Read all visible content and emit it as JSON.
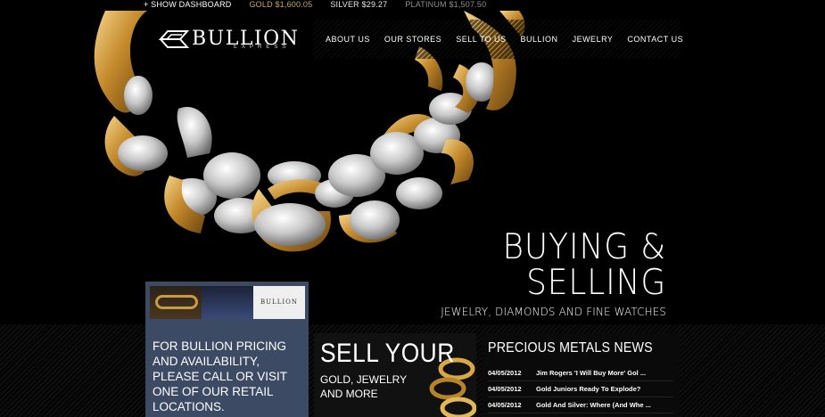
{
  "ticker": {
    "dashboard": "+ SHOW DASHBOARD",
    "gold": "GOLD $1,600.05",
    "silver": "SILVER $29.27",
    "platinum": "PLATINUM $1,507.50"
  },
  "logo": {
    "main": "BULLION",
    "sub": "EXPRESS"
  },
  "nav": [
    {
      "label": "ABOUT US"
    },
    {
      "label": "OUR STORES"
    },
    {
      "label": "SELL TO US"
    },
    {
      "label": "BULLION"
    },
    {
      "label": "JEWELRY"
    },
    {
      "label": "CONTACT US"
    }
  ],
  "hero": {
    "line1": "BUYING &",
    "line2": "SELLING",
    "subline": "JEWELRY, DIAMONDS AND FINE WATCHES"
  },
  "promo_bullion": {
    "thumb_logo": "BULLION",
    "text": "FOR BULLION PRICING AND AVAILABILITY, PLEASE CALL OR VISIT ONE OF OUR RETAIL LOCATIONS."
  },
  "promo_sell": {
    "title": "SELL YOUR",
    "subtitle": "GOLD, JEWELRY AND MORE"
  },
  "news": {
    "title": "PRECIOUS METALS NEWS",
    "items": [
      {
        "date": "04/05/2012",
        "headline": "Jim Rogers 'I Will Buy More' Gol ..."
      },
      {
        "date": "04/05/2012",
        "headline": "Gold Juniors Ready To Explode?"
      },
      {
        "date": "04/05/2012",
        "headline": "Gold And Silver: Where (And Whe ..."
      }
    ]
  },
  "colors": {
    "gold_accent": "#c9a85a",
    "panel_blue": "#3d4a63",
    "background": "#000000"
  }
}
